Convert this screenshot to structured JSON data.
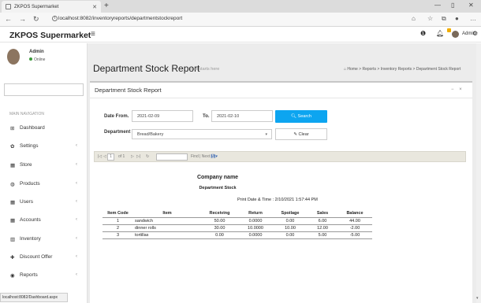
{
  "browser": {
    "tab_title": "ZKPOS Supermarket",
    "url": "localhost:8082/inventoryreports/departmentstockreport"
  },
  "header": {
    "brand": "ZKPOS Supermarket",
    "user": "Admin"
  },
  "sidebar": {
    "user_name": "Admin",
    "status": "Online",
    "nav_header": "MAIN NAVIGATION",
    "items": [
      {
        "label": "Dashboard",
        "icon": "dashboard-icon",
        "has_children": false
      },
      {
        "label": "Settings",
        "icon": "gear-icon",
        "has_children": true
      },
      {
        "label": "Store",
        "icon": "store-icon",
        "has_children": true
      },
      {
        "label": "Products",
        "icon": "products-icon",
        "has_children": true
      },
      {
        "label": "Users",
        "icon": "users-icon",
        "has_children": true
      },
      {
        "label": "Accounts",
        "icon": "accounts-icon",
        "has_children": true
      },
      {
        "label": "Inventory",
        "icon": "inventory-icon",
        "has_children": true
      },
      {
        "label": "Discount Offer",
        "icon": "plus-icon",
        "has_children": true
      },
      {
        "label": "Reports",
        "icon": "reports-icon",
        "has_children": true
      }
    ]
  },
  "page": {
    "title": "Department Stock Report",
    "subtitle": "it all starts here",
    "breadcrumbs": [
      "Home",
      "Reports",
      "Inventory Reports",
      "Department Stock Report"
    ],
    "box_title": "Department Stock Report"
  },
  "form": {
    "date_from_label": "Date From.",
    "date_from_value": "2021-02-09",
    "to_label": "To.",
    "to_value": "2021-02-10",
    "search_button": "Search",
    "department_label": "Department",
    "department_value": "Bread/Bakery",
    "clear_button": "Clear"
  },
  "report_toolbar": {
    "page_current": "1",
    "page_of": "of 1",
    "find_next": "Find | Next"
  },
  "report": {
    "company": "Company name",
    "title": "Department Stock",
    "print_date": "Print Date & Time : 2/10/2021 1:57:44 PM",
    "columns": [
      "Item Code",
      "Item",
      "Receiving",
      "Return",
      "Spoilage",
      "Sales",
      "Balance"
    ],
    "rows": [
      [
        "1",
        "sandwich",
        "50.00",
        "0.0000",
        "0.00",
        "6.00",
        "44.00"
      ],
      [
        "2",
        "dinner rolls",
        "30.00",
        "10.0000",
        "10.00",
        "12.00",
        "-2.00"
      ],
      [
        "3",
        "tortillas",
        "0.00",
        "0.0000",
        "0.00",
        "5.00",
        "-5.00"
      ]
    ]
  },
  "status_bar": "localhost:8082/Dashboard.aspx"
}
